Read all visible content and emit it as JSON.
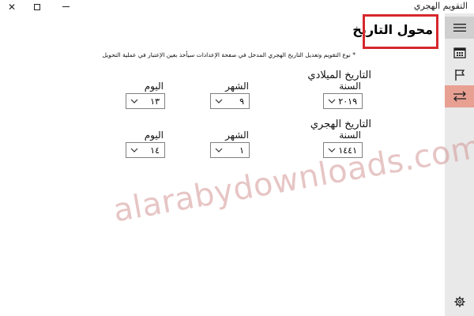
{
  "window": {
    "title": "التقويم الهجري",
    "close_glyph": "✕"
  },
  "sidebar": {
    "items": [
      {
        "icon": "hamburger-icon",
        "active": false
      },
      {
        "icon": "calendar-icon",
        "active": false
      },
      {
        "icon": "flag-icon",
        "active": false
      },
      {
        "icon": "convert-arrows-icon",
        "active": true
      }
    ],
    "footer_icon": "gear-icon"
  },
  "page": {
    "title": "محول التاريخ",
    "note": "* نوع التقويم وتعديل التاريخ الهجري المدخل في صفحة الإعدادات سيأخذ بعين الإعتبار في عملية التحويل"
  },
  "gregorian": {
    "section_label": "التاريخ الميلادي",
    "year_label": "السنة",
    "month_label": "الشهر",
    "day_label": "اليوم",
    "year": "٢٠١٩",
    "month": "٩",
    "day": "١٣"
  },
  "hijri": {
    "section_label": "التاريخ الهجري",
    "year_label": "السنة",
    "month_label": "الشهر",
    "day_label": "اليوم",
    "year": "١٤٤١",
    "month": "١",
    "day": "١٤"
  },
  "watermark": "alarabydownloads.com",
  "colors": {
    "highlight_box": "#d6282c",
    "active_tab": "#e8a092",
    "sidebar_bg": "#e9e9e9"
  }
}
